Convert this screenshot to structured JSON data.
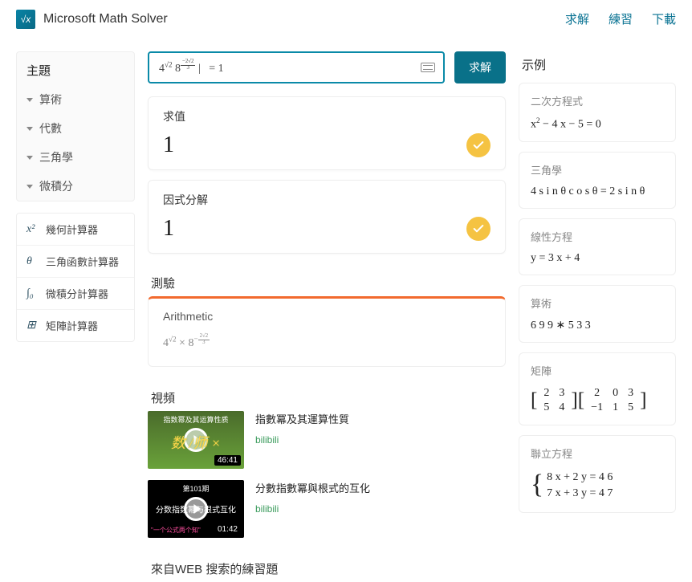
{
  "header": {
    "logo_icon_text": "√x",
    "title": "Microsoft Math Solver",
    "nav": [
      "求解",
      "練習",
      "下載"
    ]
  },
  "sidebar": {
    "title": "主題",
    "items": [
      "算術",
      "代數",
      "三角學",
      "微積分"
    ]
  },
  "calculators": {
    "items": [
      {
        "icon": "x²",
        "label": "幾何計算器"
      },
      {
        "icon": "θ",
        "label": "三角函數計算器"
      },
      {
        "icon": "∫₀",
        "label": "微積分計算器"
      },
      {
        "icon": "⊞",
        "label": "矩陣計算器"
      }
    ]
  },
  "search": {
    "expression_html": "4<sup>√2</sup> 8<sup><span class='frac'><span class='n'>−2√2</span><span class='d'>3</span></span></sup> |&nbsp;&nbsp;&nbsp;= 1",
    "solve_label": "求解"
  },
  "results": [
    {
      "title": "求值",
      "value": "1"
    },
    {
      "title": "因式分解",
      "value": "1"
    }
  ],
  "quiz": {
    "heading": "測驗",
    "category": "Arithmetic",
    "expression_html": "4<sup>√2</sup> × 8<sup>−<span class='frac'><span class='n'>2√2</span><span class='d'>3</span></span></sup>"
  },
  "videos": {
    "heading": "視頻",
    "items": [
      {
        "thumb_top": "指数幂及其运算性质",
        "thumb_mid": "数 /师 ×",
        "duration": "46:41",
        "title": "指數冪及其運算性質",
        "source": "bilibili",
        "variant": "vt1"
      },
      {
        "thumb_top": "第101期",
        "thumb_mid": "分数指数幂与根式互化",
        "thumb_bot": "\"一个公式两个知\"",
        "duration": "01:42",
        "title": "分數指數冪與根式的互化",
        "source": "bilibili",
        "variant": "vt2"
      }
    ]
  },
  "web_practice": {
    "heading": "來自WEB 搜索的練習題"
  },
  "examples": {
    "title": "示例",
    "items": [
      {
        "category": "二次方程式",
        "expr_html": "x<sup>2</sup> − 4 x − 5 = 0"
      },
      {
        "category": "三角學",
        "expr_html": "4 s i n θ c o s θ = 2 s i n θ"
      },
      {
        "category": "線性方程",
        "expr_html": "y = 3 x + 4"
      },
      {
        "category": "算術",
        "expr_html": "6 9 9 ∗ 5 3 3"
      },
      {
        "category": "矩陣",
        "expr_html": "<span class='brk'>[</span><table class='mtx'><tr><td>2</td><td>3</td></tr><tr><td>5</td><td>4</td></tr></table><span class='brk'>]</span><span class='brk'>[</span><table class='mtx'><tr><td>2</td><td>0</td><td>3</td></tr><tr><td>−1</td><td>1</td><td>5</td></tr></table><span class='brk'>]</span>"
      },
      {
        "category": "聯立方程",
        "expr_html": "<span class='lbrace'>{</span><table class='sys'><tr><td>8 x + 2 y = 4 6</td></tr><tr><td>7 x + 3 y = 4 7</td></tr></table>"
      }
    ]
  }
}
